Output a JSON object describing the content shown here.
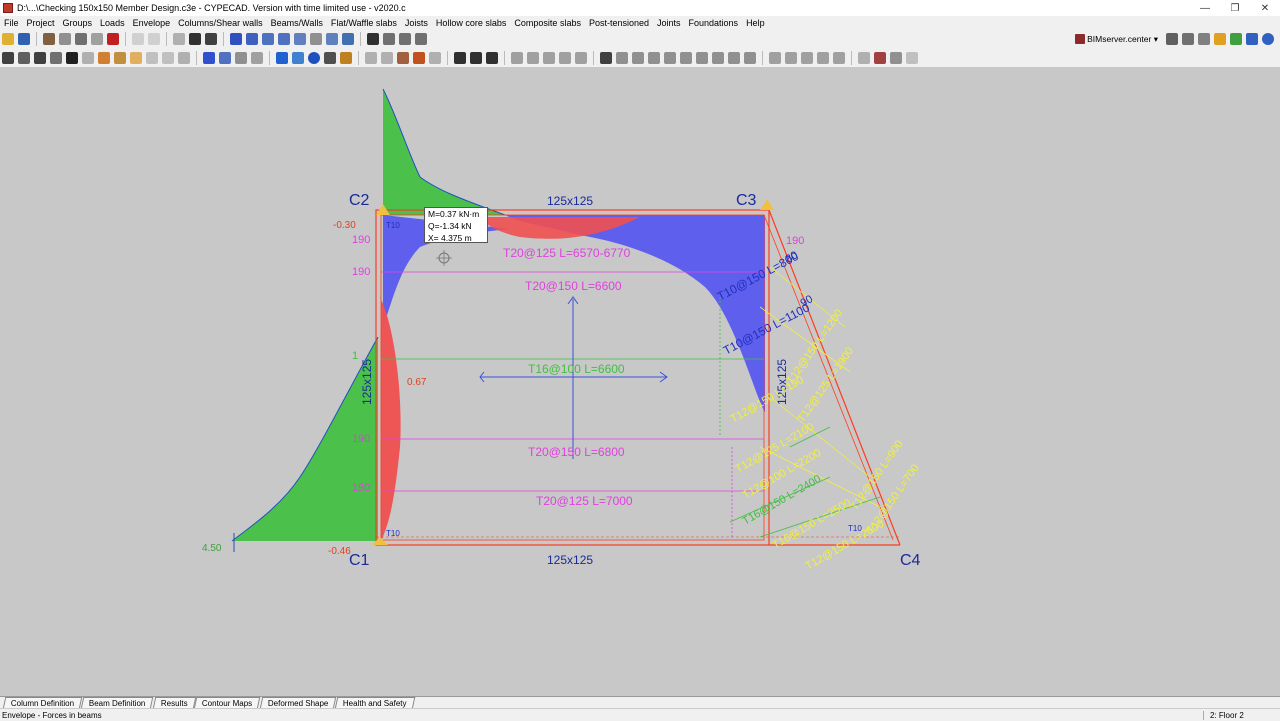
{
  "window": {
    "title": "D:\\...\\Checking 150x150 Member Design.c3e - CYPECAD. Version with time limited use - v2020.c",
    "minimize": "—",
    "restore": "❐",
    "close": "✕"
  },
  "menu": [
    "File",
    "Project",
    "Groups",
    "Loads",
    "Envelope",
    "Columns/Shear walls",
    "Beams/Walls",
    "Flat/Waffle slabs",
    "Joists",
    "Hollow core slabs",
    "Composite slabs",
    "Post-tensioned",
    "Joints",
    "Foundations",
    "Help"
  ],
  "toolbar": {
    "bimserver_label": "BIMserver.center"
  },
  "drawing": {
    "columns": {
      "c1": "C1",
      "c2": "C2",
      "c3": "C3",
      "c4": "C4"
    },
    "beams": {
      "top": "125x125",
      "bottom": "125x125",
      "left": "125x125",
      "right": "125x125"
    },
    "values": {
      "v_030": "-0.30",
      "v_046": "-0.46",
      "v_450": "4.50",
      "v_067": "0.67",
      "v_190": "190",
      "v_80": "80",
      "v_90": "90",
      "v_100": "100",
      "v_130": "130",
      "v_1": "1"
    },
    "bar_labels": {
      "t10_top": "T10",
      "t10_bottom": "T10",
      "t10_right": "T10",
      "t20_125_a": "T20@125 L=6570-6770",
      "t20_150_a": "T20@150 L=6600",
      "t16_100": "T16@100 L=6600",
      "t20_150_b": "T20@150 L=6800",
      "t20_125_b": "T20@125 L=7000",
      "t10_150_800": "T10@150 L=800",
      "t10_150_1100": "T10@150 L=1100",
      "y_l1": "T12@150 L=190",
      "y_l2": "T12@125 L=2100",
      "y_l3": "T12@100 L=2200",
      "y_l4": "T16@150 L=2400",
      "y_l5": "T16@150 L=2500",
      "y_l6": "T12@150 L=2600",
      "y_l7": "T12@150 L=1200",
      "y_l8": "T12@150 L=900",
      "y_l9": "T12@150 L=700",
      "y_l10": "T12@125 L=1900"
    }
  },
  "tooltip": {
    "m": "M=0.37 kN·m",
    "q": "Q=-1.34 kN",
    "x": "X= 4.375 m"
  },
  "tabs": [
    "Column Definition",
    "Beam Definition",
    "Results",
    "Contour Maps",
    "Deformed Shape",
    "Health and Safety"
  ],
  "status": {
    "left": "Envelope - Forces in beams",
    "right": "2: Floor 2"
  },
  "colors": {
    "bg": "#c8c8c8",
    "moment_green": "#40c040",
    "moment_blue": "#5a5af0",
    "moment_red": "#f05050",
    "magenta": "#e040e0",
    "yellow": "#f0f040",
    "outline": "#ff3b1f"
  }
}
